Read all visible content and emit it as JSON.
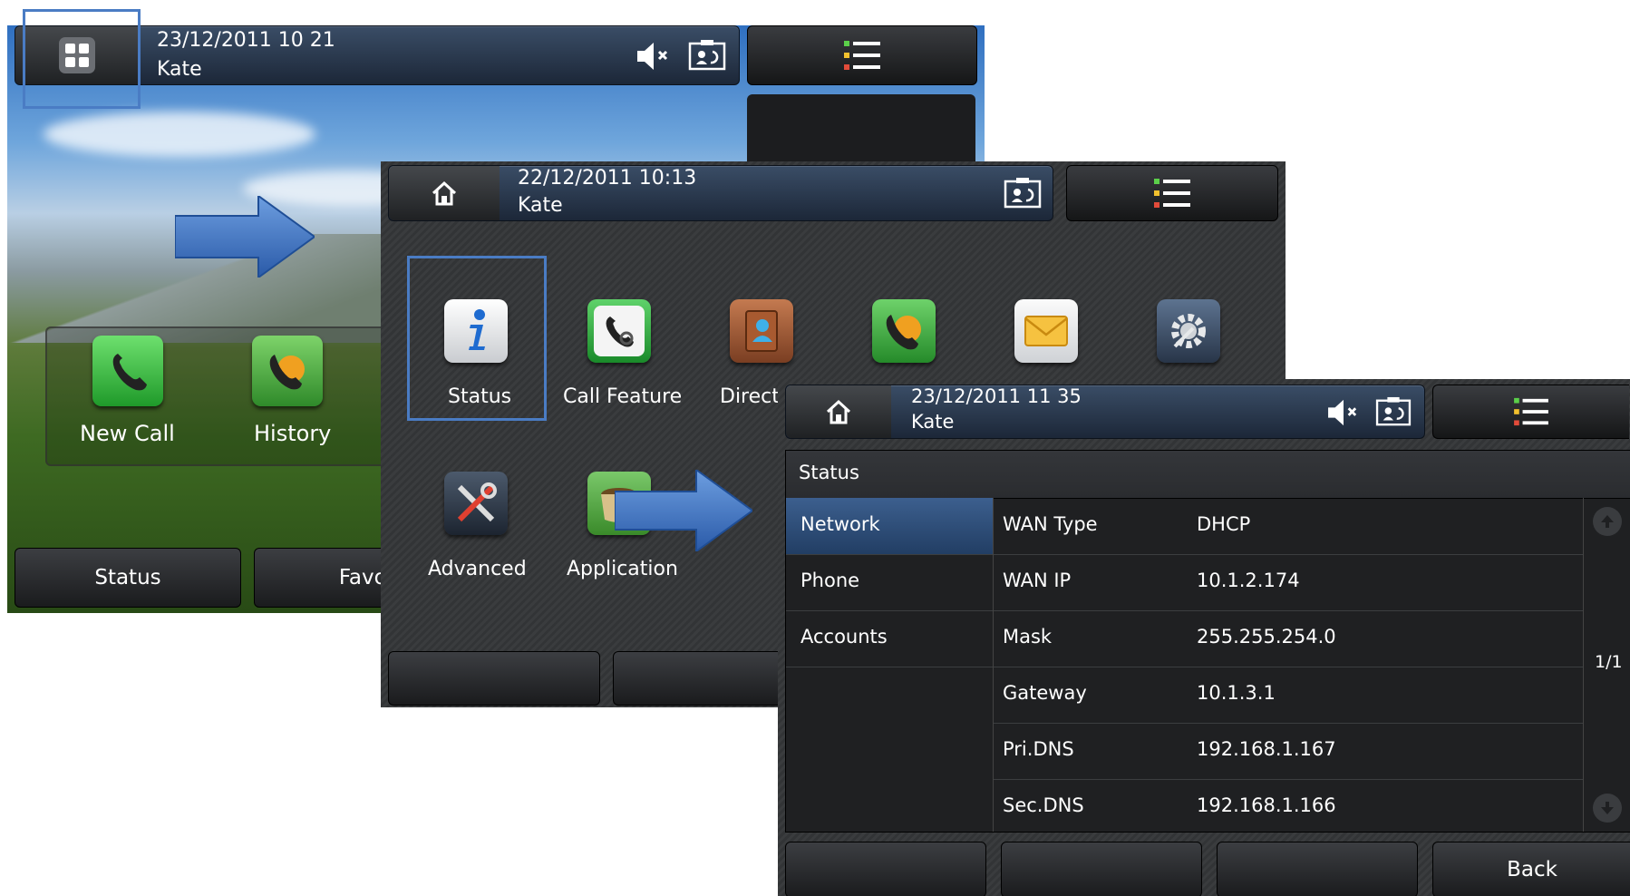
{
  "screen1": {
    "datetime": "23/12/2011 10 21",
    "user": "Kate",
    "dock": {
      "items": [
        {
          "label": "New Call",
          "icon": "phone-icon"
        },
        {
          "label": "History",
          "icon": "history-icon"
        }
      ]
    },
    "softkeys": [
      "Status",
      "Favor"
    ]
  },
  "screen2": {
    "datetime": "22/12/2011 10:13",
    "user": "Kate",
    "apps": [
      {
        "label": "Status",
        "icon": "info-icon"
      },
      {
        "label": "Call Feature",
        "icon": "call-feature-icon"
      },
      {
        "label": "Directo",
        "icon": "directory-icon"
      },
      {
        "label": "",
        "icon": "history-icon"
      },
      {
        "label": "",
        "icon": "message-icon"
      },
      {
        "label": "",
        "icon": "settings-icon"
      },
      {
        "label": "Advanced",
        "icon": "tools-icon"
      },
      {
        "label": "Application",
        "icon": "application-icon"
      }
    ]
  },
  "screen3": {
    "datetime": "23/12/2011 11 35",
    "user": "Kate",
    "panel_title": "Status",
    "tabs": [
      "Network",
      "Phone",
      "Accounts"
    ],
    "active_tab": "Network",
    "rows": [
      {
        "label": "WAN Type",
        "value": "DHCP"
      },
      {
        "label": "WAN IP",
        "value": "10.1.2.174"
      },
      {
        "label": "Mask",
        "value": "255.255.254.0"
      },
      {
        "label": "Gateway",
        "value": "10.1.3.1"
      },
      {
        "label": "Pri.DNS",
        "value": "192.168.1.167"
      },
      {
        "label": "Sec.DNS",
        "value": "192.168.1.166"
      }
    ],
    "page_indicator": "1/1",
    "softkeys": [
      "",
      "",
      "",
      "Back"
    ]
  },
  "colors": {
    "highlight": "#4a7cc4",
    "active_tab": "#2c4a72",
    "arrow": "#3e74c6"
  }
}
